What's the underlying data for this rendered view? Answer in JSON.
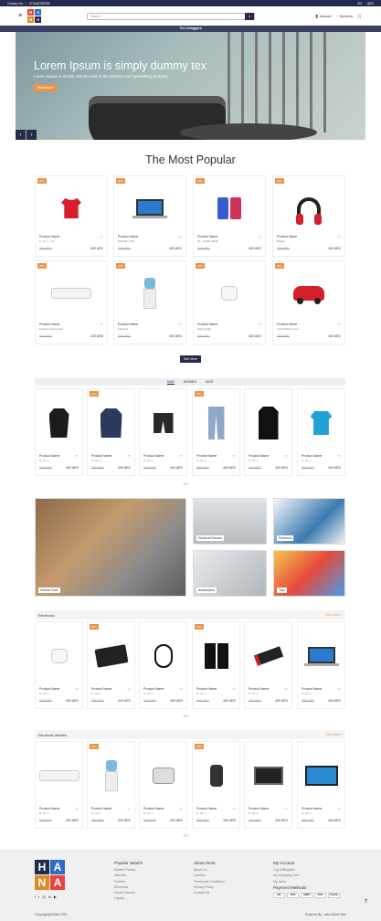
{
  "topbar": {
    "contact": "Contact Us: 📞 971456789789",
    "lang": "EN",
    "currency": "AED"
  },
  "header": {
    "search_placeholder": "Search",
    "account": "Account",
    "my_items": "My Items",
    "logo": [
      "H",
      "A",
      "N",
      "A"
    ]
  },
  "nav": {
    "title": "The shinggers"
  },
  "hero": {
    "title": "Lorem Ipsum is simply dummy tex",
    "subtitle": "Lorem Ipsum is simply dummy text of the printing and typesetting industry.",
    "button": "Read More",
    "prev": "‹",
    "next": "›"
  },
  "popular": {
    "title": "The Most Popular",
    "see_more": "See More",
    "products": [
      {
        "badge": "20%",
        "name": "Product Name",
        "desc": "S - M - L - XL",
        "old": "300 AED",
        "new": "400 AED",
        "icon": "tshirt"
      },
      {
        "badge": "20%",
        "name": "Product Name",
        "desc": "i5|12GB | 1TB",
        "old": "300 AED",
        "new": "400 AED",
        "icon": "laptop"
      },
      {
        "badge": "20%",
        "name": "Product Name",
        "desc": "S5 - 16GB | 64GB",
        "old": "300 AED",
        "new": "400 AED",
        "icon": "phone"
      },
      {
        "badge": "20%",
        "name": "Product Name",
        "desc": "Beats2",
        "old": "300 AED",
        "new": "400 AED",
        "icon": "headphones"
      },
      {
        "badge": "20%",
        "name": "Product Name",
        "desc": "5 Hours | Hot & Cold",
        "old": "300 AED",
        "new": "400 AED",
        "icon": "ac"
      },
      {
        "badge": "20%",
        "name": "Product Name",
        "desc": "3 Rooms",
        "old": "300 AED",
        "new": "400 AED",
        "icon": "water"
      },
      {
        "badge": "20%",
        "name": "Product Name",
        "desc": "High Quality",
        "old": "300 AED",
        "new": "400 AED",
        "icon": "airpods"
      },
      {
        "badge": "20%",
        "name": "Product Name",
        "desc": "Tech Kiddie & more",
        "old": "300 AED",
        "new": "400 AED",
        "icon": "car"
      }
    ]
  },
  "fashion": {
    "tabs": [
      "MAN",
      "WOMEN",
      "KIDS"
    ],
    "products": [
      {
        "badge": "",
        "name": "Product Name",
        "desc": "S - M - L",
        "old": "300 AED",
        "new": "400 AED",
        "icon": "shirt"
      },
      {
        "badge": "20%",
        "name": "Product Name",
        "desc": "S - M - L",
        "old": "300 AED",
        "new": "400 AED",
        "icon": "jacket"
      },
      {
        "badge": "",
        "name": "Product Name",
        "desc": "S - M - L",
        "old": "300 AED",
        "new": "400 AED",
        "icon": "shorts"
      },
      {
        "badge": "20%",
        "name": "Product Name",
        "desc": "S - M - L",
        "old": "300 AED",
        "new": "400 AED",
        "icon": "jeans"
      },
      {
        "badge": "",
        "name": "Product Name",
        "desc": "S - M - L",
        "old": "300 AED",
        "new": "400 AED",
        "icon": "suit"
      },
      {
        "badge": "",
        "name": "Product Name",
        "desc": "S - M - L",
        "old": "300 AED",
        "new": "400 AED",
        "icon": "polo"
      }
    ]
  },
  "promos": {
    "kitchen": "Kitchen Tools",
    "electrical": "Electrical Devices",
    "electronic": "Electronic",
    "accessories": "Accessories",
    "toys": "Toys"
  },
  "electronics": {
    "title": "Electronic",
    "see_more": "See More ›",
    "products": [
      {
        "badge": "",
        "name": "Product Name",
        "desc": "S - M - L",
        "old": "300 AED",
        "new": "400 AED",
        "icon": "airpods"
      },
      {
        "badge": "20%",
        "name": "Product Name",
        "desc": "S - M - L",
        "old": "300 AED",
        "new": "400 AED",
        "icon": "tablet"
      },
      {
        "badge": "",
        "name": "Product Name",
        "desc": "S - M - L",
        "old": "300 AED",
        "new": "400 AED",
        "icon": "earphones"
      },
      {
        "badge": "20%",
        "name": "Product Name",
        "desc": "S - M - L",
        "old": "300 AED",
        "new": "400 AED",
        "icon": "speakers"
      },
      {
        "badge": "",
        "name": "Product Name",
        "desc": "S - M - L",
        "old": "300 AED",
        "new": "400 AED",
        "icon": "charger"
      },
      {
        "badge": "",
        "name": "Product Name",
        "desc": "S - M - L",
        "old": "300 AED",
        "new": "400 AED",
        "icon": "laptop"
      }
    ]
  },
  "electrical": {
    "title": "Electrical devices",
    "see_more": "See More ›",
    "products": [
      {
        "badge": "",
        "name": "Product Name",
        "desc": "S - M - L",
        "old": "300 AED",
        "new": "400 AED",
        "icon": "ac"
      },
      {
        "badge": "20%",
        "name": "Product Name",
        "desc": "S - M - L",
        "old": "300 AED",
        "new": "400 AED",
        "icon": "water"
      },
      {
        "badge": "",
        "name": "Product Name",
        "desc": "S - M - L",
        "old": "300 AED",
        "new": "400 AED",
        "icon": "scale"
      },
      {
        "badge": "20%",
        "name": "Product Name",
        "desc": "S - M - L",
        "old": "300 AED",
        "new": "400 AED",
        "icon": "shaver"
      },
      {
        "badge": "",
        "name": "Product Name",
        "desc": "S - M - L",
        "old": "300 AED",
        "new": "400 AED",
        "icon": "microwave"
      },
      {
        "badge": "",
        "name": "Product Name",
        "desc": "S - M - L",
        "old": "300 AED",
        "new": "400 AED",
        "icon": "tv"
      }
    ]
  },
  "footer": {
    "popular_search": {
      "title": "Popular Search",
      "items": [
        "Mobile Phones",
        "Watches",
        "Fashion",
        "Electronic",
        "Home Devices",
        "Laptop"
      ]
    },
    "about": {
      "title": "About Store",
      "items": [
        "About Us",
        "Careers",
        "Terms and Conditions",
        "Privacy Policy",
        "Contact Us"
      ]
    },
    "account": {
      "title": "My Account",
      "items": [
        "Log In/Register",
        "My Shopping Cart",
        "My Items"
      ]
    },
    "payment": {
      "title": "Payment Methods",
      "methods": [
        "MC",
        "VISA",
        "AMEX",
        "VISA",
        "PayPal"
      ]
    },
    "social": [
      "f",
      "t",
      "◎",
      "in",
      "▶"
    ],
    "copyright": "Copyright@HANA 2021",
    "powered": "Powered By : Idea World Web"
  }
}
